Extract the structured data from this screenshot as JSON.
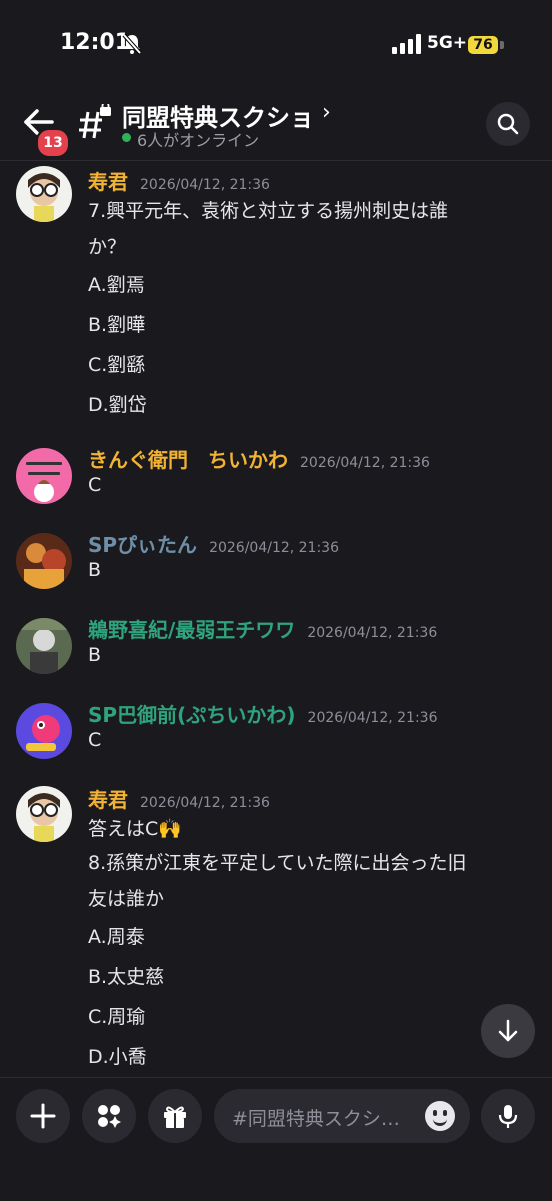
{
  "status": {
    "time": "12:01",
    "network": "5G+",
    "battery": "76"
  },
  "header": {
    "unread": "13",
    "channel": "同盟特典スクショ",
    "chevron": "›",
    "online": "6人がオンライン"
  },
  "messages": [
    {
      "user": "寿君",
      "time": "2026/04/12, 21:36",
      "color": "#f2b233",
      "lines": [
        "7.興平元年、袁術と対立する揚州刺史は誰",
        "か？",
        "A.劉焉",
        "B.劉曄",
        "C.劉繇",
        "D.劉岱"
      ]
    },
    {
      "user": "きんぐ衛門　ちいかわ",
      "time": "2026/04/12, 21:36",
      "color": "#f2b233",
      "lines": [
        "C"
      ]
    },
    {
      "user": "SPぴぃたん",
      "time": "2026/04/12, 21:36",
      "color": "#6f8fa8",
      "lines": [
        "B"
      ]
    },
    {
      "user": "鵜野喜紀/最弱王チワワ",
      "time": "2026/04/12, 21:36",
      "color": "#2fa37c",
      "lines": [
        "B"
      ]
    },
    {
      "user": "SP巴御前(ぷちいかわ)",
      "time": "2026/04/12, 21:36",
      "color": "#2fa37c",
      "lines": [
        "C"
      ]
    },
    {
      "user": "寿君",
      "time": "2026/04/12, 21:36",
      "color": "#f2b233",
      "lines": [
        "答えはC🙌",
        "8.孫策が江東を平定していた際に出会った旧",
        "友は誰か",
        "A.周泰",
        "B.太史慈",
        "C.周瑜",
        "D.小喬"
      ]
    }
  ],
  "composer": {
    "placeholder": "#同盟特典スクシ…"
  }
}
